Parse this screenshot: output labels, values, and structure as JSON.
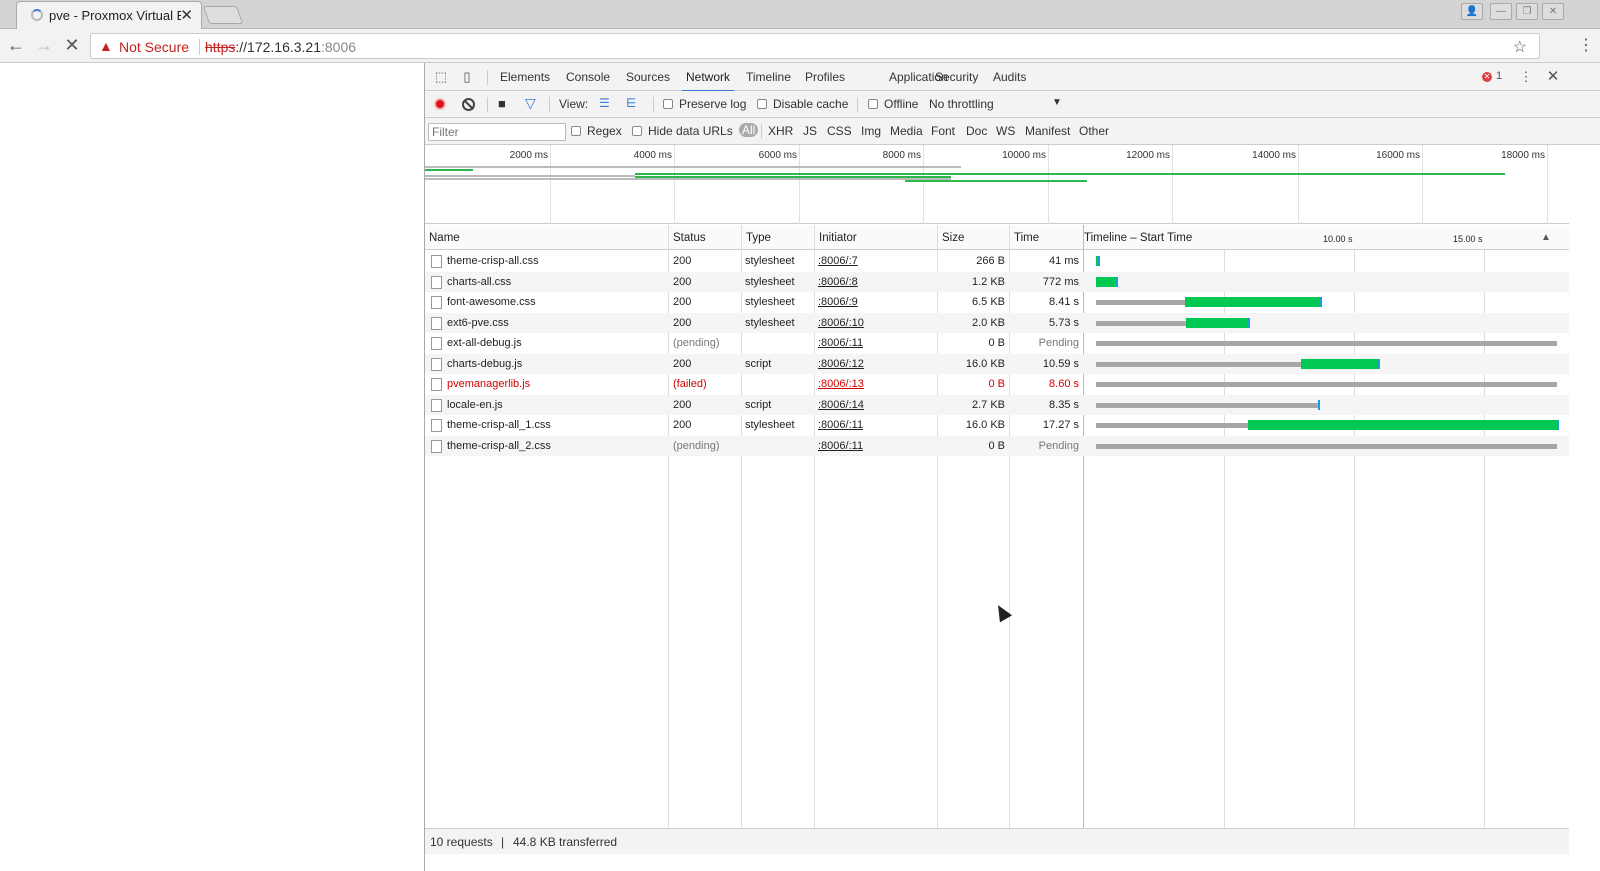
{
  "browser": {
    "tab_title": "pve - Proxmox Virtual E",
    "security_label": "Not Secure",
    "url_scheme": "https",
    "url_rest": "://172.16.3.21",
    "url_port": ":8006"
  },
  "devtools": {
    "tabs": [
      "Elements",
      "Console",
      "Sources",
      "Network",
      "Timeline",
      "Profiles",
      "Application",
      "Security",
      "Audits"
    ],
    "active_tab": "Network",
    "error_count": "1",
    "toolbar": {
      "view_label": "View:",
      "preserve_log": "Preserve log",
      "disable_cache": "Disable cache",
      "offline": "Offline",
      "throttling": "No throttling"
    },
    "filter": {
      "placeholder": "Filter",
      "regex": "Regex",
      "hide_data_urls": "Hide data URLs",
      "types": [
        "All",
        "XHR",
        "JS",
        "CSS",
        "Img",
        "Media",
        "Font",
        "Doc",
        "WS",
        "Manifest",
        "Other"
      ],
      "selected_type": "All"
    },
    "overview_ticks": [
      "2000 ms",
      "4000 ms",
      "6000 ms",
      "8000 ms",
      "10000 ms",
      "12000 ms",
      "14000 ms",
      "16000 ms",
      "18000 ms"
    ],
    "columns": {
      "name": "Name",
      "status": "Status",
      "type": "Type",
      "initiator": "Initiator",
      "size": "Size",
      "time": "Time",
      "timeline": "Timeline – Start Time",
      "tick1": "10.00 s",
      "tick2": "15.00 s"
    },
    "requests": [
      {
        "name": "theme-crisp-all.css",
        "status": "200",
        "type": "stylesheet",
        "initiator": ":8006/:7",
        "size": "266 B",
        "time": "41 ms"
      },
      {
        "name": "charts-all.css",
        "status": "200",
        "type": "stylesheet",
        "initiator": ":8006/:8",
        "size": "1.2 KB",
        "time": "772 ms"
      },
      {
        "name": "font-awesome.css",
        "status": "200",
        "type": "stylesheet",
        "initiator": ":8006/:9",
        "size": "6.5 KB",
        "time": "8.41 s"
      },
      {
        "name": "ext6-pve.css",
        "status": "200",
        "type": "stylesheet",
        "initiator": ":8006/:10",
        "size": "2.0 KB",
        "time": "5.73 s"
      },
      {
        "name": "ext-all-debug.js",
        "status": "(pending)",
        "type": "",
        "initiator": ":8006/:11",
        "size": "0 B",
        "time": "Pending"
      },
      {
        "name": "charts-debug.js",
        "status": "200",
        "type": "script",
        "initiator": ":8006/:12",
        "size": "16.0 KB",
        "time": "10.59 s"
      },
      {
        "name": "pvemanagerlib.js",
        "status": "(failed)",
        "type": "",
        "initiator": ":8006/:13",
        "size": "0 B",
        "time": "8.60 s"
      },
      {
        "name": "locale-en.js",
        "status": "200",
        "type": "script",
        "initiator": ":8006/:14",
        "size": "2.7 KB",
        "time": "8.35 s"
      },
      {
        "name": "theme-crisp-all_1.css",
        "status": "200",
        "type": "stylesheet",
        "initiator": ":8006/:11",
        "size": "16.0 KB",
        "time": "17.27 s"
      },
      {
        "name": "theme-crisp-all_2.css",
        "status": "(pending)",
        "type": "",
        "initiator": ":8006/:11",
        "size": "0 B",
        "time": "Pending"
      }
    ],
    "summary": {
      "requests": "10 requests",
      "transferred": "44.8 KB transferred"
    }
  }
}
